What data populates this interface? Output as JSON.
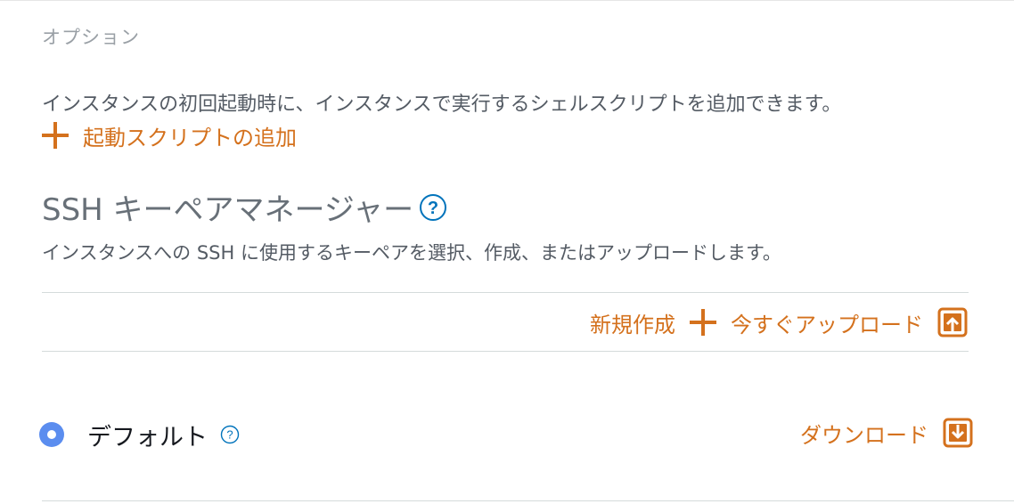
{
  "options": {
    "label": "オプション"
  },
  "startup_script": {
    "description": "インスタンスの初回起動時に、インスタンスで実行するシェルスクリプトを追加できます。",
    "add_label": "起動スクリプトの追加"
  },
  "ssh": {
    "title": "SSH キーペアマネージャー",
    "description": "インスタンスへの SSH に使用するキーペアを選択、作成、またはアップロードします。",
    "create_new_label": "新規作成",
    "upload_label": "今すぐアップロード",
    "keys": [
      {
        "name": "デフォルト",
        "selected": true,
        "download_label": "ダウンロード"
      }
    ]
  },
  "colors": {
    "accent": "#d4711d",
    "help_blue": "#0073bb",
    "radio_blue": "#5b8def"
  }
}
